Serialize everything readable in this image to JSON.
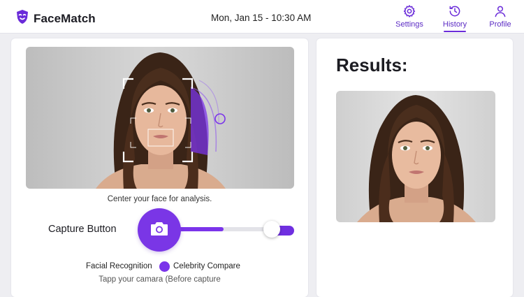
{
  "app": {
    "name": "FaceMatch",
    "logo_icon": "face-mask-icon",
    "accent": "#7b34ea"
  },
  "header": {
    "datetime": "Mon, Jan 15 - 10:30 AM",
    "nav": [
      {
        "label": "Settings",
        "icon": "gear-icon",
        "active": false
      },
      {
        "label": "History",
        "icon": "clock-icon",
        "active": true
      },
      {
        "label": "Profile",
        "icon": "user-icon",
        "active": false
      }
    ]
  },
  "capture": {
    "hint": "Center your face for analysis.",
    "button_label": "Capture Button",
    "button_icon": "camera-icon",
    "slider_fraction": 0.85,
    "modes": [
      {
        "label": "Facial Recognition",
        "selected": false
      },
      {
        "label": "Celebrity Compare",
        "selected": true
      }
    ],
    "tip": "Tapp your camara (Before capture"
  },
  "results": {
    "title": "Results:"
  }
}
